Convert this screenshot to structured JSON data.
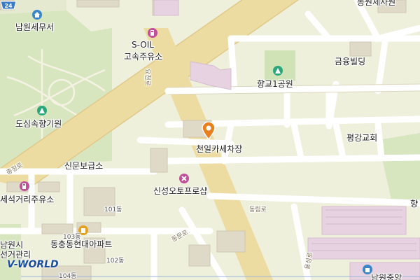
{
  "map": {
    "route_number": "24",
    "brand": "V-WORLD",
    "places": [
      {
        "id": "namwon-tax",
        "label": "남원세무서"
      },
      {
        "id": "soil",
        "label": "S-OIL"
      },
      {
        "id": "soil-2",
        "label": "고속주유소"
      },
      {
        "id": "hyanggyo-park",
        "label": "향교1공원"
      },
      {
        "id": "geumyong",
        "label": "금융빌딩"
      },
      {
        "id": "dosim",
        "label": "도심속향기원"
      },
      {
        "id": "cheonil",
        "label": "천일카세차장"
      },
      {
        "id": "pyeonggang",
        "label": "평강교회"
      },
      {
        "id": "sinmun",
        "label": "신문보급소"
      },
      {
        "id": "sinseong",
        "label": "신성오토프로샵"
      },
      {
        "id": "gas-station-2",
        "label": "세석거리주유소"
      },
      {
        "id": "dongchung",
        "label": "동충동현대아파트"
      },
      {
        "id": "namwon-city",
        "label": "남원시"
      },
      {
        "id": "election",
        "label": "선거관리"
      }
    ],
    "small_labels": [
      {
        "id": "bldg-101",
        "label": "101동"
      },
      {
        "id": "bldg-102",
        "label": "102동"
      },
      {
        "id": "bldg-103",
        "label": "103동"
      },
      {
        "id": "bldg-104",
        "label": "104동"
      }
    ],
    "roads": [
      {
        "id": "road-diag",
        "label": "요천로"
      },
      {
        "id": "road-left",
        "label": "충정로"
      },
      {
        "id": "road-dongrim",
        "label": "동림로"
      },
      {
        "id": "road-dongmun",
        "label": "동문로"
      },
      {
        "id": "road-bottom",
        "label": "용성로"
      }
    ],
    "edge_labels": [
      {
        "id": "top-right",
        "label": "동원제사원"
      },
      {
        "id": "right-edge",
        "label": "향"
      },
      {
        "id": "bottom-right",
        "label": "남원중앙"
      }
    ]
  }
}
